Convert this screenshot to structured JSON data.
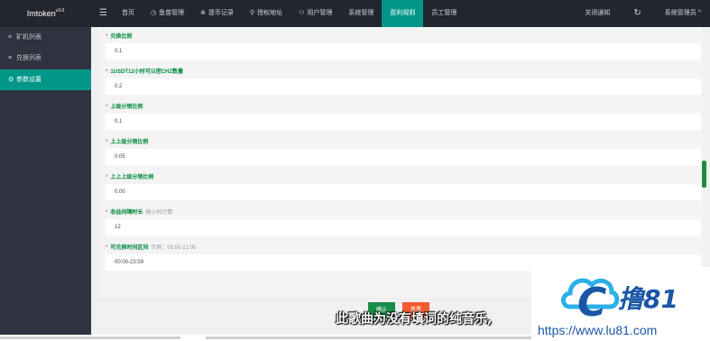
{
  "app": {
    "name": "Imtoken",
    "version": "v3.0"
  },
  "header": {
    "nav": [
      {
        "icon": "",
        "label": "首页",
        "active": false
      },
      {
        "icon": "◷",
        "label": "鱼苗管理",
        "active": false
      },
      {
        "icon": "⊗",
        "label": "提币记录",
        "active": false
      },
      {
        "icon": "⚲",
        "label": "授权地址",
        "active": false
      },
      {
        "icon": "⚇",
        "label": "用户管理",
        "active": false
      },
      {
        "icon": "",
        "label": "系统管理",
        "active": false
      },
      {
        "icon": "",
        "label": "盈利规则",
        "active": true
      },
      {
        "icon": "",
        "label": "员工管理",
        "active": false
      }
    ],
    "right": {
      "close_notice": "关闭通知",
      "refresh_icon": "↻",
      "admin": "系统管理员 ^"
    }
  },
  "sidebar": {
    "items": [
      {
        "icon": "≡",
        "label": "矿机列表",
        "active": false
      },
      {
        "icon": "≡",
        "label": "兑换列表",
        "active": false
      },
      {
        "icon": "⚙",
        "label": "参数设置",
        "active": true
      }
    ]
  },
  "form": {
    "fields": [
      {
        "label": "兑换比例",
        "hint": "",
        "value": "0.1"
      },
      {
        "label": "1USDT12小时可以挖CHZ数量",
        "hint": "",
        "value": "0.2"
      },
      {
        "label": "上级分销比例",
        "hint": "",
        "value": "0.1"
      },
      {
        "label": "上上级分销比例",
        "hint": "",
        "value": "0.05"
      },
      {
        "label": "上上上级分销比例",
        "hint": "",
        "value": "0.00"
      },
      {
        "label": "收益间隔时长",
        "hint": "按小时计算",
        "value": "12"
      },
      {
        "label": "可兑换时间区间",
        "hint": "示例：08:00-21:00",
        "value": "00:00-23:59"
      }
    ],
    "buttons": {
      "save": "确认",
      "reset": "重置"
    }
  },
  "overlay": {
    "caption": "此歌曲为没有填词的纯音乐,",
    "watermark_logo": "撸81",
    "watermark_url": "https://www.lu81.com"
  }
}
